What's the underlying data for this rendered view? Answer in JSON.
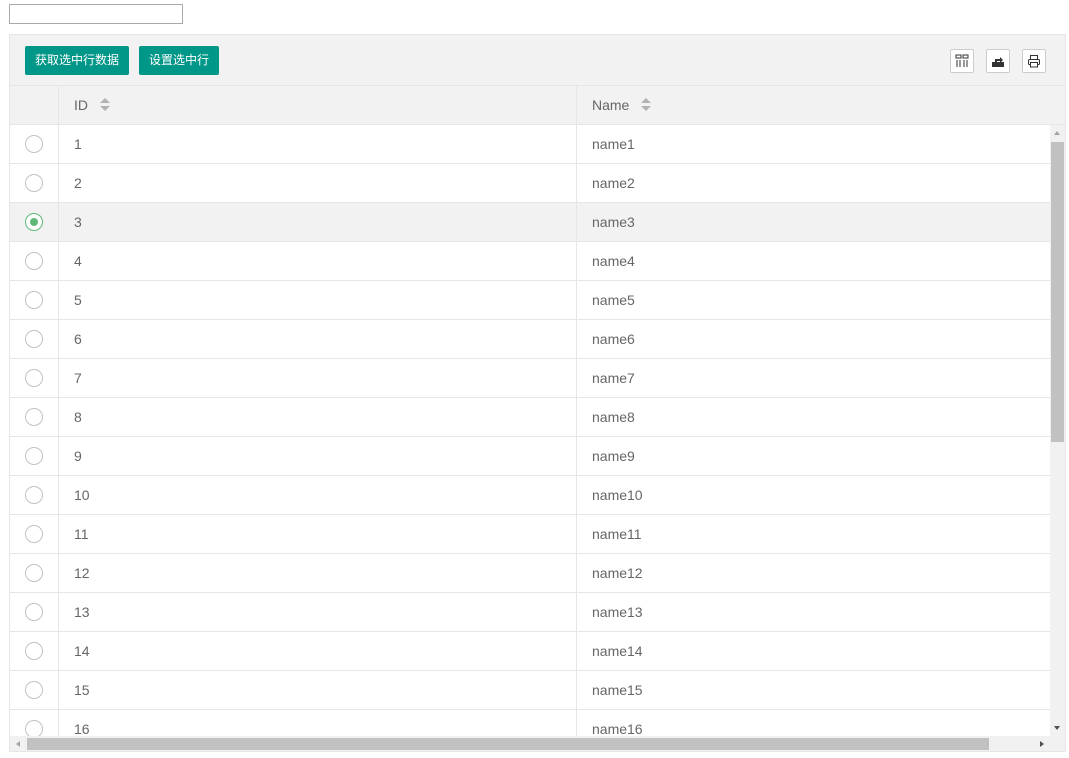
{
  "search": {
    "value": "",
    "placeholder": ""
  },
  "toolbar": {
    "get_selected_label": "获取选中行数据",
    "set_selected_label": "设置选中行",
    "tools": [
      {
        "name": "columns-filter",
        "icon": "columns-icon"
      },
      {
        "name": "export",
        "icon": "export-icon"
      },
      {
        "name": "print",
        "icon": "print-icon"
      }
    ]
  },
  "table": {
    "columns": [
      {
        "key": "id",
        "label": "ID",
        "sortable": true
      },
      {
        "key": "name",
        "label": "Name",
        "sortable": true
      }
    ],
    "rows": [
      {
        "id": "1",
        "name": "name1",
        "selected": false
      },
      {
        "id": "2",
        "name": "name2",
        "selected": false
      },
      {
        "id": "3",
        "name": "name3",
        "selected": true
      },
      {
        "id": "4",
        "name": "name4",
        "selected": false
      },
      {
        "id": "5",
        "name": "name5",
        "selected": false
      },
      {
        "id": "6",
        "name": "name6",
        "selected": false
      },
      {
        "id": "7",
        "name": "name7",
        "selected": false
      },
      {
        "id": "8",
        "name": "name8",
        "selected": false
      },
      {
        "id": "9",
        "name": "name9",
        "selected": false
      },
      {
        "id": "10",
        "name": "name10",
        "selected": false
      },
      {
        "id": "11",
        "name": "name11",
        "selected": false
      },
      {
        "id": "12",
        "name": "name12",
        "selected": false
      },
      {
        "id": "13",
        "name": "name13",
        "selected": false
      },
      {
        "id": "14",
        "name": "name14",
        "selected": false
      },
      {
        "id": "15",
        "name": "name15",
        "selected": false
      },
      {
        "id": "16",
        "name": "name16",
        "selected": false
      }
    ]
  },
  "colors": {
    "accent": "#009688",
    "radio_checked": "#5fb878",
    "header_bg": "#f2f2f2",
    "border": "#e6e6e6"
  }
}
